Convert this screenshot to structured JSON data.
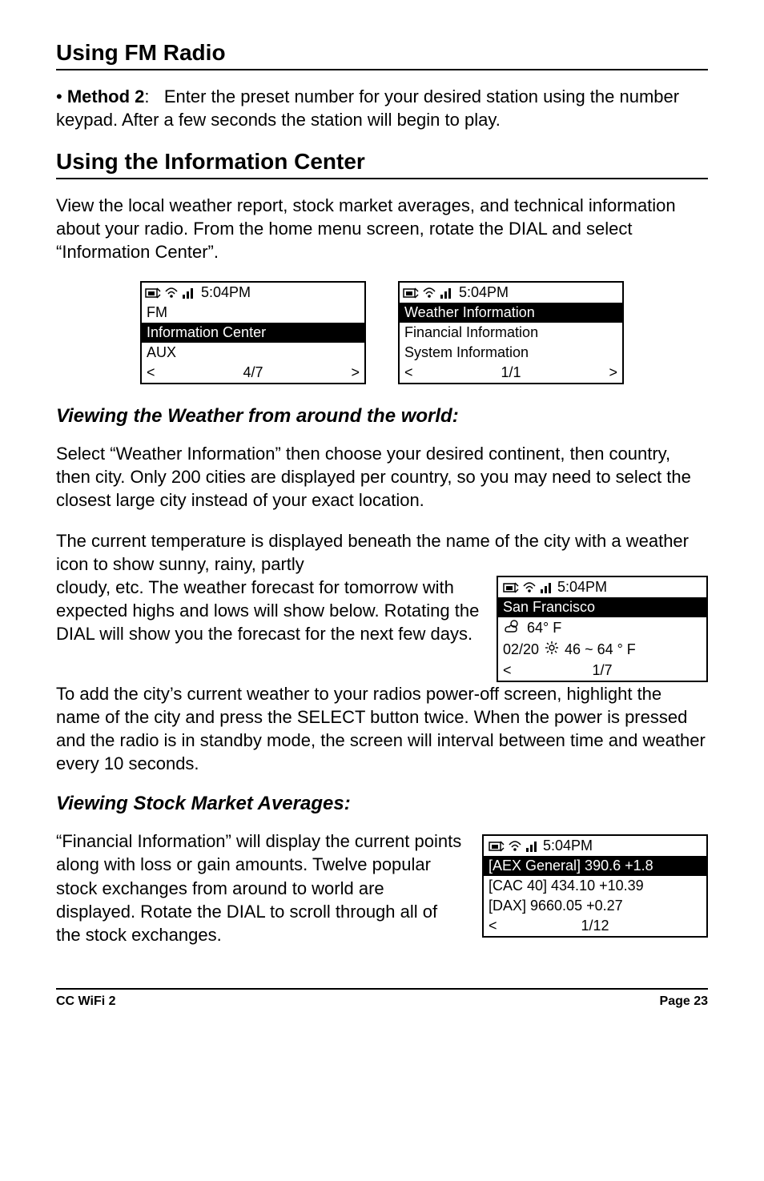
{
  "headings": {
    "h1": "Using FM Radio",
    "h2": "Using the Information Center",
    "sub1": "Viewing the Weather from around the world:",
    "sub2": "Viewing Stock Market Averages:"
  },
  "paragraphs": {
    "method2": "• Method 2:   Enter the preset number for your desired station using the number keypad. After a few seconds the station will begin to play.",
    "method2_label": "Method 2",
    "infoCenterIntro": "View the local weather report, stock market averages, and technical information about your radio. From the home menu screen, rotate the DIAL and select “Information Center”.",
    "weather1": "Select “Weather Information” then choose your desired continent, then country, then city. Only 200 cities are displayed per country, so you may need to select the closest large city instead of your exact location.",
    "weather2a": "The current temperature is displayed beneath the name of the city with a weather icon to show sunny, rainy, partly",
    "weather2b": "cloudy, etc. The weather forecast for tomorrow with expected highs and lows will show below. Rotating the DIAL will show you the forecast for the next few days.",
    "weather3": "To add the city’s current weather to your radios power-off screen, highlight the name of the city and press the SELECT button twice. When the power is pressed and the radio is in standby mode, the screen will interval between time and weather every 10 seconds.",
    "stock1": "“Financial Information” will display the current points along with loss or gain amounts. Twelve popular stock exchanges from around to world are displayed. Rotate the DIAL to scroll through all of the stock exchanges."
  },
  "screen_main": {
    "time": "5:04PM",
    "r1": "FM",
    "r2": "Information Center",
    "r3": "AUX",
    "page": "4/7"
  },
  "screen_info": {
    "time": "5:04PM",
    "r1": "Weather Information",
    "r2": "Financial Information",
    "r3": "System Information",
    "page": "1/1"
  },
  "screen_weather": {
    "time": "5:04PM",
    "title": "San Francisco",
    "line1": "64° F",
    "line2_date": "02/20",
    "line2_range": "46 ~ 64 ° F",
    "page": "1/7"
  },
  "screen_stock": {
    "time": "5:04PM",
    "r1": "[AEX General] 390.6 +1.8",
    "r2": "[CAC 40] 434.10 +10.39",
    "r3": "[DAX] 9660.05 +0.27",
    "page": "1/12"
  },
  "footer": {
    "left": "CC WiFi 2",
    "right": "Page 23"
  }
}
